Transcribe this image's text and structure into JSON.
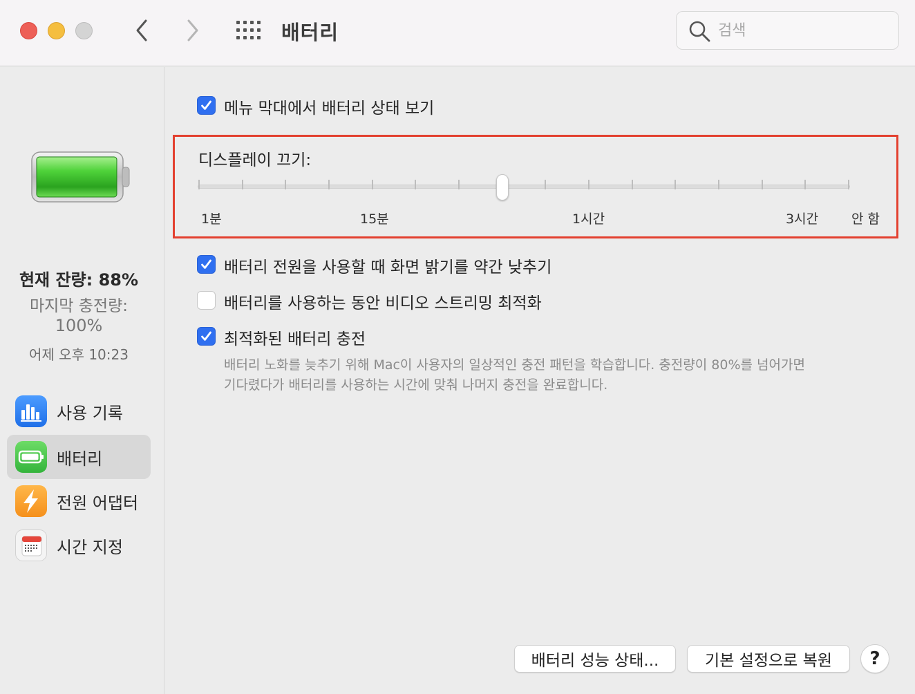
{
  "window": {
    "title": "배터리",
    "search_placeholder": "검색"
  },
  "sidebar": {
    "current_charge": "현재 잔량: 88%",
    "last_charged_label": "마지막 충전량:",
    "last_charged_value": "100%",
    "last_charged_time": "어제 오후 10:23",
    "battery_level": 0.88,
    "items": [
      {
        "label": "사용 기록",
        "icon": "bar-chart-icon",
        "selected": false
      },
      {
        "label": "배터리",
        "icon": "battery-icon",
        "selected": true
      },
      {
        "label": "전원 어댑터",
        "icon": "lightning-icon",
        "selected": false
      },
      {
        "label": "시간 지정",
        "icon": "calendar-icon",
        "selected": false
      }
    ]
  },
  "main": {
    "show_in_menu_bar": {
      "label": "메뉴 막대에서 배터리 상태 보기",
      "checked": true
    },
    "display_off": {
      "title": "디스플레이 끄기:",
      "tick_labels": [
        "1분",
        "15분",
        "1시간",
        "3시간",
        "안 함"
      ],
      "tick_count": 16,
      "value_tick_index": 7
    },
    "dim_display": {
      "label": "배터리 전원을 사용할 때 화면 밝기를 약간 낮추기",
      "checked": true
    },
    "optimize_video": {
      "label": "배터리를 사용하는 동안 비디오 스트리밍 최적화",
      "checked": false
    },
    "optimized_charging": {
      "label": "최적화된 배터리 충전",
      "checked": true,
      "description_line1": "배터리 노화를 늦추기 위해 Mac이 사용자의 일상적인 충전 패턴을 학습합니다. 충전량이 80%를 넘어가면",
      "description_line2": "기다렸다가 배터리를 사용하는 시간에 맞춰 나머지 충전을 완료합니다."
    },
    "buttons": {
      "battery_health": "배터리 성능 상태...",
      "restore_defaults": "기본 설정으로 복원",
      "help": "?"
    }
  },
  "colors": {
    "accent_blue": "#2f6ff0",
    "highlight_red": "#e3402f",
    "battery_green": "#38c52c"
  }
}
